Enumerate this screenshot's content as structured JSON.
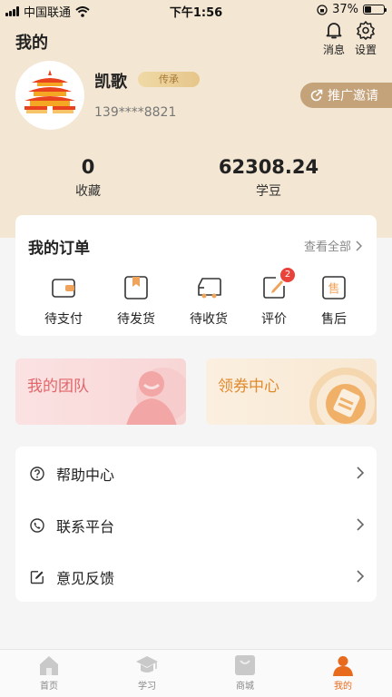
{
  "status_bar": {
    "carrier": "中国联通",
    "time": "下午1:56",
    "battery": "37%",
    "battery_level": 0.37
  },
  "header": {
    "title": "我的",
    "messages_label": "消息",
    "settings_label": "设置"
  },
  "profile": {
    "name": "凯歌",
    "level": "传承",
    "phone": "139****8821",
    "promo_label": "推广邀请"
  },
  "stats": [
    {
      "value": "0",
      "label": "收藏"
    },
    {
      "value": "62308.24",
      "label": "学豆"
    }
  ],
  "orders": {
    "title": "我的订单",
    "view_all": "查看全部",
    "items": [
      {
        "label": "待支付",
        "icon": "wallet-icon"
      },
      {
        "label": "待发货",
        "icon": "package-icon"
      },
      {
        "label": "待收货",
        "icon": "truck-icon"
      },
      {
        "label": "评价",
        "icon": "edit-icon",
        "badge": "2"
      },
      {
        "label": "售后",
        "icon": "after-sale-icon",
        "icon_text": "售"
      }
    ]
  },
  "banners": [
    {
      "label": "我的团队",
      "color": "#e0666a"
    },
    {
      "label": "领券中心",
      "color": "#e08a2e"
    }
  ],
  "menu": [
    {
      "label": "帮助中心",
      "icon": "help-icon"
    },
    {
      "label": "联系平台",
      "icon": "phone-icon"
    },
    {
      "label": "意见反馈",
      "icon": "feedback-icon"
    }
  ],
  "tabbar": [
    {
      "label": "首页",
      "icon": "home-icon"
    },
    {
      "label": "学习",
      "icon": "graduation-cap-icon"
    },
    {
      "label": "商城",
      "icon": "shopping-bag-icon"
    },
    {
      "label": "我的",
      "icon": "user-icon",
      "active": true
    }
  ],
  "colors": {
    "accent": "#e86a1c",
    "header_bg": "#f3e6d2",
    "badge": "#e8423b",
    "promo": "#c4a27a"
  }
}
